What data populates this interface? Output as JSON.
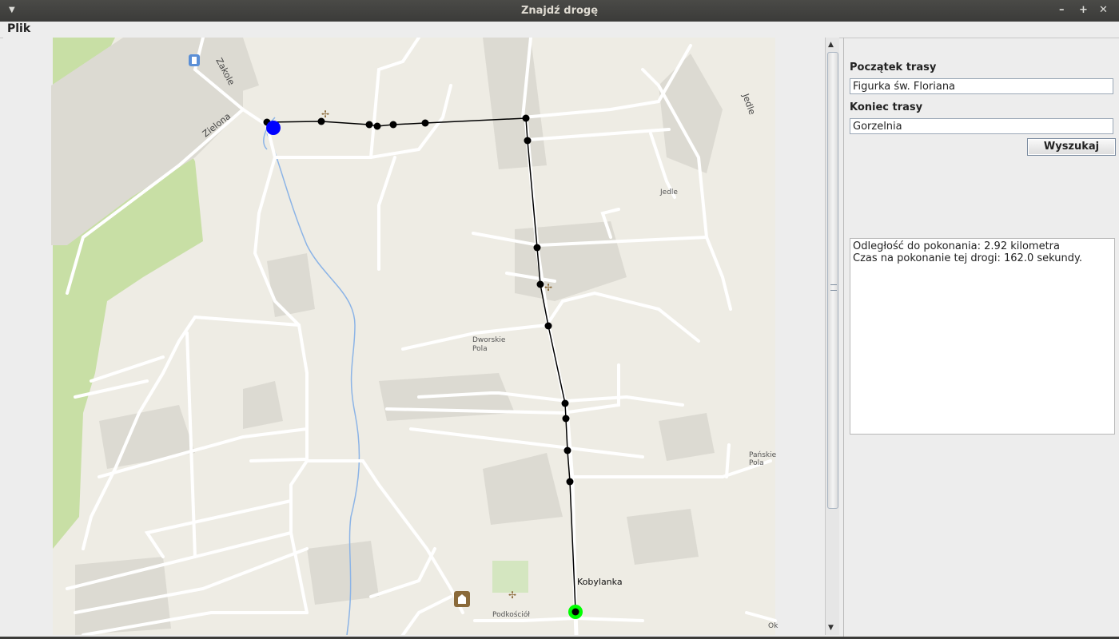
{
  "window": {
    "title": "Znajdź drogę",
    "controls": [
      "–",
      "+",
      "✕"
    ]
  },
  "menubar": {
    "file_label": "Plik"
  },
  "map": {
    "place_labels": {
      "zakole": "Zakole",
      "zielona": "Zielona",
      "jedle_road": "Jedle",
      "jedle": "Jedle",
      "dworskie_pola_1": "Dworskie",
      "dworskie_pola_2": "Pola",
      "panskie_pola_1": "Pańskie",
      "panskie_pola_2": "Pola",
      "kobylanka": "Kobylanka",
      "podkosciol": "Podkościół",
      "ok": "Ok"
    },
    "colors": {
      "background": "#eeece4",
      "road": "#ffffff",
      "building": "#d9d7cf",
      "forest": "#c8dfa5",
      "river": "#8cb4e6",
      "route": "#000000",
      "start_marker": "#0000ff",
      "end_marker": "#00ff00"
    }
  },
  "panel": {
    "start_label": "Początek trasy",
    "start_value": "Figurka św. Floriana",
    "end_label": "Koniec trasy",
    "end_value": "Gorzelnia",
    "search_button": "Wyszukaj",
    "result_lines": [
      "Odległość do pokonania: 2.92 kilometra",
      "Czas na pokonanie tej drogi: 162.0 sekundy."
    ]
  }
}
